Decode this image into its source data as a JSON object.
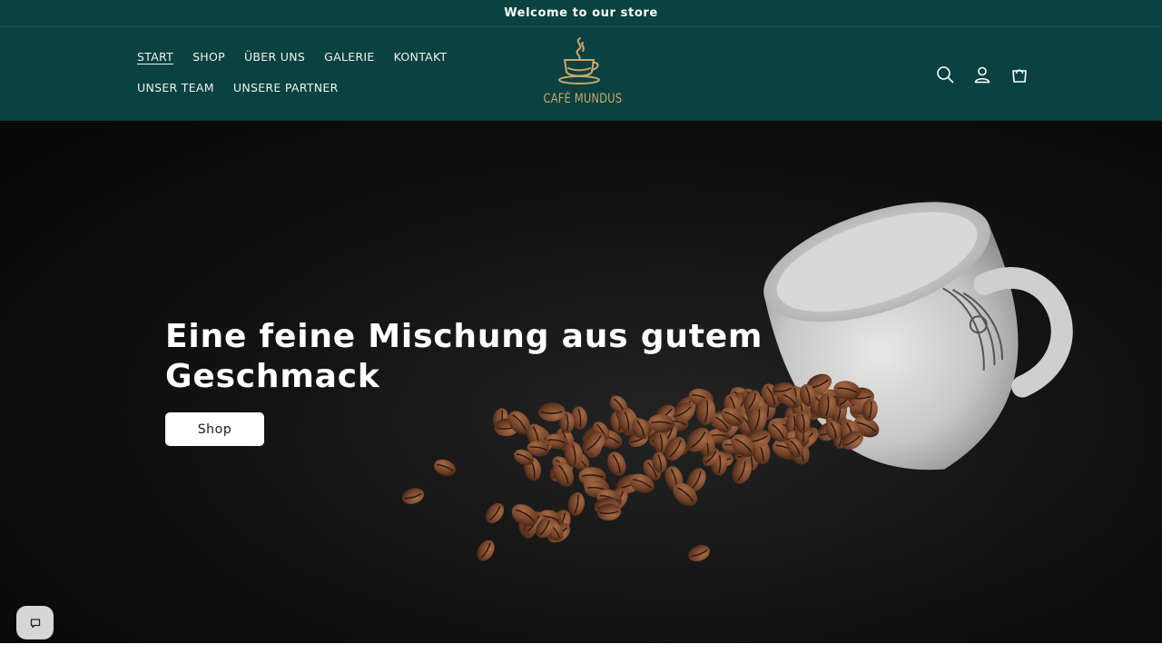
{
  "announcement": {
    "text": "Welcome to our store"
  },
  "nav": {
    "row1": [
      "START",
      "SHOP",
      "ÜBER UNS",
      "GALERIE",
      "KONTAKT"
    ],
    "row2": [
      "UNSER TEAM",
      "UNSERE PARTNER"
    ],
    "active": "START"
  },
  "logo": {
    "text": "CAFÉ MUNDUS",
    "icon": "coffee-cup-icon"
  },
  "header_icons": [
    "search-icon",
    "account-icon",
    "cart-icon"
  ],
  "hero": {
    "title": "Eine feine Mischung aus gutem Geschmack",
    "button_label": "Shop",
    "image": "coffee-cup-with-spilled-beans"
  },
  "chat": {
    "icon": "chat-icon"
  },
  "colors": {
    "header_bg": "#0a4141",
    "logo_gold": "#c9a86a",
    "hero_bg": "#1a1a1a",
    "bean": "#7a4a2e",
    "button_bg": "#ffffff"
  }
}
